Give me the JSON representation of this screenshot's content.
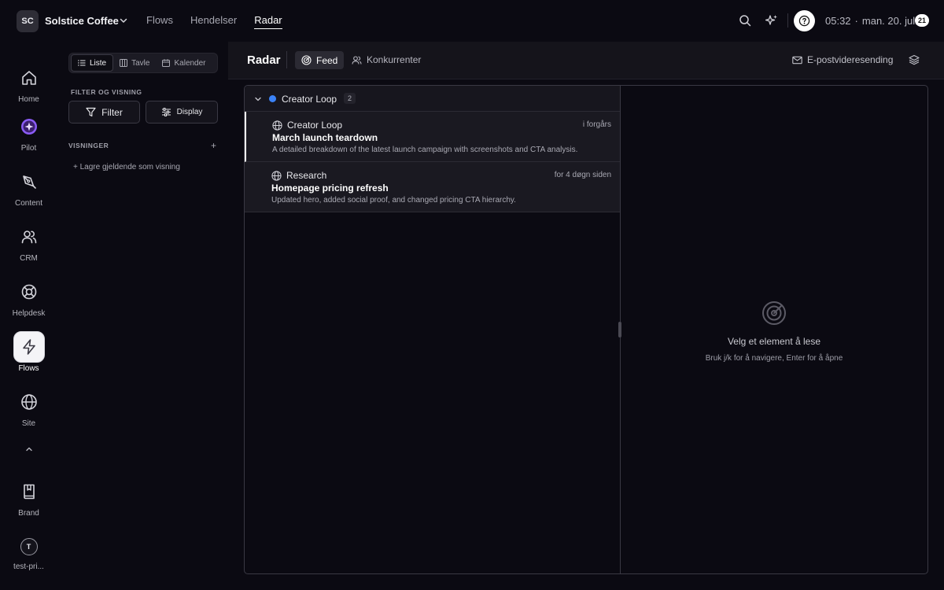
{
  "workspace": {
    "initials": "SC",
    "name": "Solstice Coffee"
  },
  "topnav": {
    "items": [
      "Flows",
      "Hendelser",
      "Radar"
    ],
    "active": "Radar"
  },
  "topbar": {
    "time": "05:32",
    "separator": "·",
    "date": "man. 20. juli",
    "day_badge": "21"
  },
  "rail": {
    "items": [
      {
        "label": "Home",
        "icon": "home-icon"
      },
      {
        "label": "Pilot",
        "icon": "pilot-icon"
      },
      {
        "label": "Content",
        "icon": "pen-icon"
      },
      {
        "label": "CRM",
        "icon": "users-icon"
      },
      {
        "label": "Helpdesk",
        "icon": "lifebuoy-icon"
      },
      {
        "label": "Flows",
        "icon": "bolt-icon"
      },
      {
        "label": "Site",
        "icon": "globe-icon"
      },
      {
        "label": "Brand",
        "icon": "book-icon"
      }
    ],
    "active": "Flows",
    "user": {
      "initial": "T",
      "label": "test-pri..."
    }
  },
  "sidebar": {
    "view_tabs": [
      "Liste",
      "Tavle",
      "Kalender"
    ],
    "active_view": "Liste",
    "filter_section": "FILTER OG VISNING",
    "filter_label": "Filter",
    "display_label": "Display",
    "views_section": "VISNINGER",
    "add_view": "+",
    "save_view": "+ Lagre gjeldende som visning"
  },
  "main": {
    "title": "Radar",
    "tabs": [
      "Feed",
      "Konkurrenter"
    ],
    "active_tab": "Feed",
    "email_forward": "E-postvideresending"
  },
  "feed": {
    "group": {
      "name": "Creator Loop",
      "count": "2",
      "color": "#3b82f6"
    },
    "items": [
      {
        "source": "Creator Loop",
        "time": "i forgårs",
        "title": "March launch teardown",
        "description": "A detailed breakdown of the latest launch campaign with screenshots and CTA analysis."
      },
      {
        "source": "Research",
        "time": "for 4 døgn siden",
        "title": "Homepage pricing refresh",
        "description": "Updated hero, added social proof, and changed pricing CTA hierarchy."
      }
    ]
  },
  "reader": {
    "empty_title": "Velg et element å lese",
    "empty_hint": "Bruk j/k for å navigere, Enter for å åpne"
  }
}
